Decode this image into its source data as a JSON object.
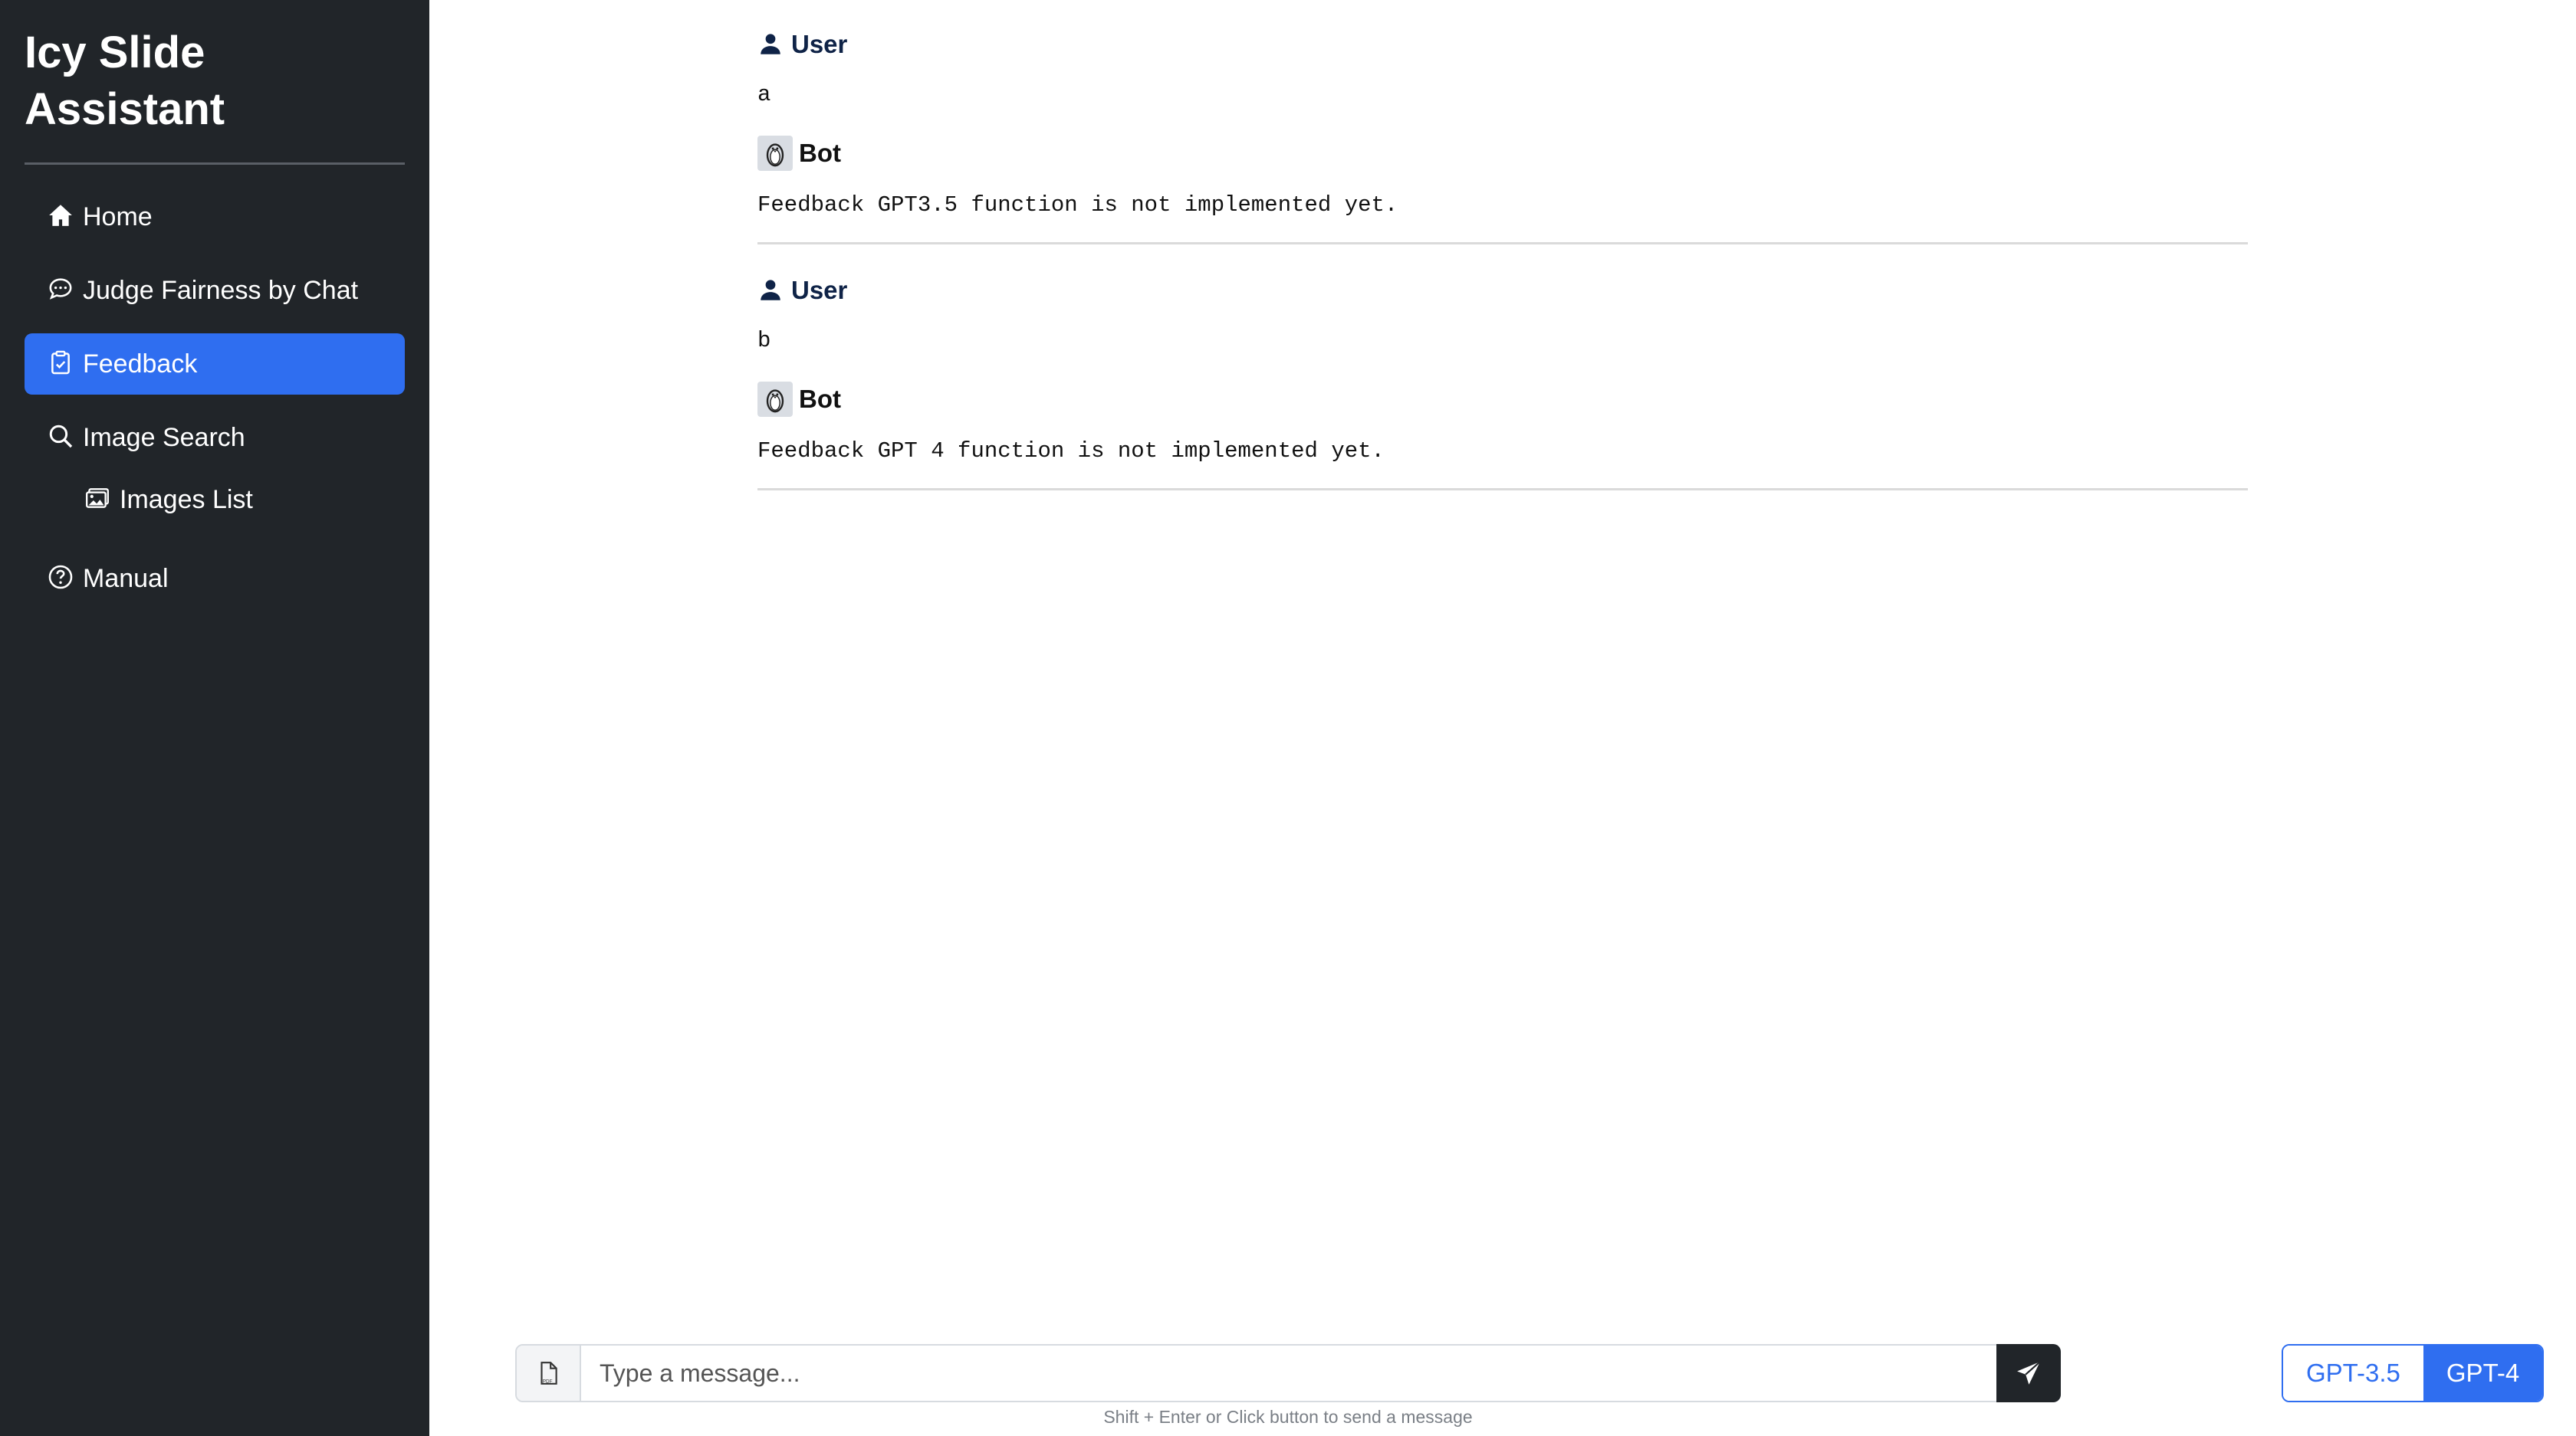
{
  "app": {
    "title": "Icy Slide Assistant"
  },
  "sidebar": {
    "items": [
      {
        "label": "Home",
        "icon": "house-icon",
        "active": false
      },
      {
        "label": "Judge Fairness by Chat",
        "icon": "chat-icon",
        "active": false
      },
      {
        "label": "Feedback",
        "icon": "clipboard-icon",
        "active": true
      },
      {
        "label": "Image Search",
        "icon": "search-icon",
        "active": false
      },
      {
        "label": "Images List",
        "icon": "images-icon",
        "active": false
      },
      {
        "label": "Manual",
        "icon": "question-icon",
        "active": false
      }
    ]
  },
  "chat": {
    "messages": [
      {
        "role": "User",
        "text": "a"
      },
      {
        "role": "Bot",
        "text": "Feedback GPT3.5 function is not implemented yet."
      },
      {
        "role": "User",
        "text": "b"
      },
      {
        "role": "Bot",
        "text": "Feedback GPT 4 function is not implemented yet."
      }
    ]
  },
  "input": {
    "placeholder": "Type a message...",
    "hint": "Shift + Enter or Click button to send a message"
  },
  "models": {
    "options": [
      "GPT-3.5",
      "GPT-4"
    ],
    "selected": "GPT-4"
  },
  "colors": {
    "sidebar_bg": "#212529",
    "active_nav": "#2f6ef0",
    "user_role": "#0f2347"
  }
}
